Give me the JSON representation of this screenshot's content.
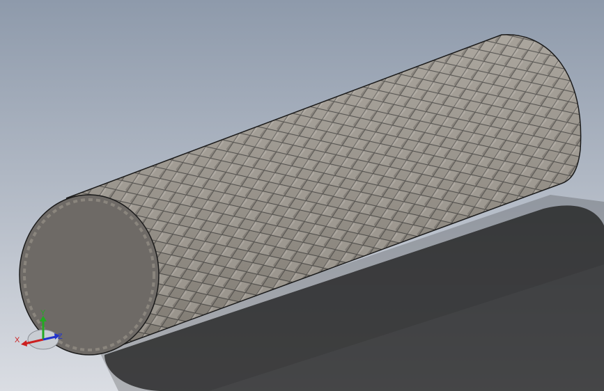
{
  "viewport": {
    "background_top": "#8e9aab",
    "background_bottom": "#d8dce2"
  },
  "model": {
    "name": "knurled-cylinder",
    "body_color": "#8f8a82",
    "end_face_color": "#6e6a66",
    "edge_color": "#1a1a1a",
    "knurl_pattern": "diamond"
  },
  "triad": {
    "x_label": "X",
    "y_label": "Y",
    "z_label": "Z",
    "x_color": "#cc1f1f",
    "y_color": "#22aa22",
    "z_color": "#2233cc"
  }
}
